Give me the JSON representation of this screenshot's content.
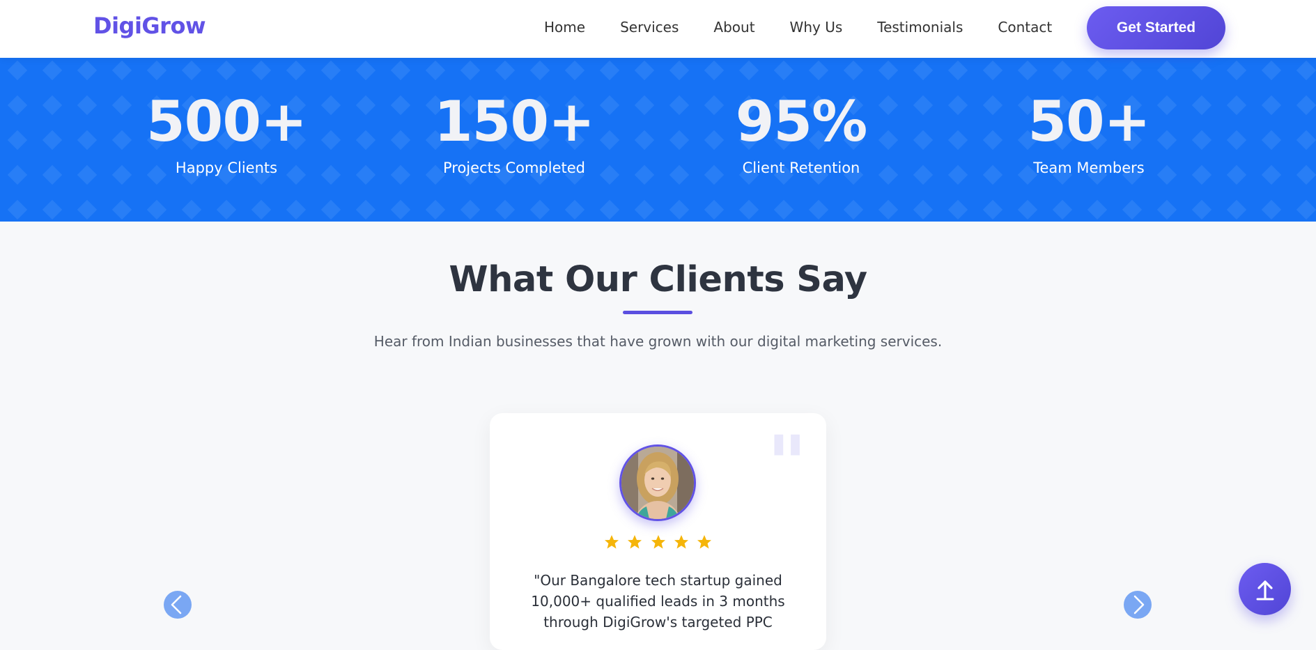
{
  "brand": {
    "name": "DigiGrow",
    "color": "#6152e6"
  },
  "nav": {
    "items": [
      {
        "label": "Home"
      },
      {
        "label": "Services"
      },
      {
        "label": "About"
      },
      {
        "label": "Why Us"
      },
      {
        "label": "Testimonials"
      },
      {
        "label": "Contact"
      }
    ],
    "cta_label": "Get Started"
  },
  "stats": {
    "background_color": "#1672f5",
    "items": [
      {
        "value": "500+",
        "label": "Happy Clients"
      },
      {
        "value": "150+",
        "label": "Projects Completed"
      },
      {
        "value": "95%",
        "label": "Client Retention"
      },
      {
        "value": "50+",
        "label": "Team Members"
      }
    ]
  },
  "testimonials": {
    "title": "What Our Clients Say",
    "subtitle": "Hear from Indian businesses that have grown with our digital marketing services.",
    "current": {
      "rating": 5,
      "quote": "\"Our Bangalore tech startup gained 10,000+ qualified leads in 3 months through DigiGrow's targeted PPC"
    },
    "prev_icon": "chevron-left-icon",
    "next_icon": "chevron-right-icon"
  },
  "scroll_top_icon": "arrow-up-icon",
  "colors": {
    "accent": "#6152e6",
    "star": "#f5b50a",
    "arrow": "#7aa7f3"
  }
}
